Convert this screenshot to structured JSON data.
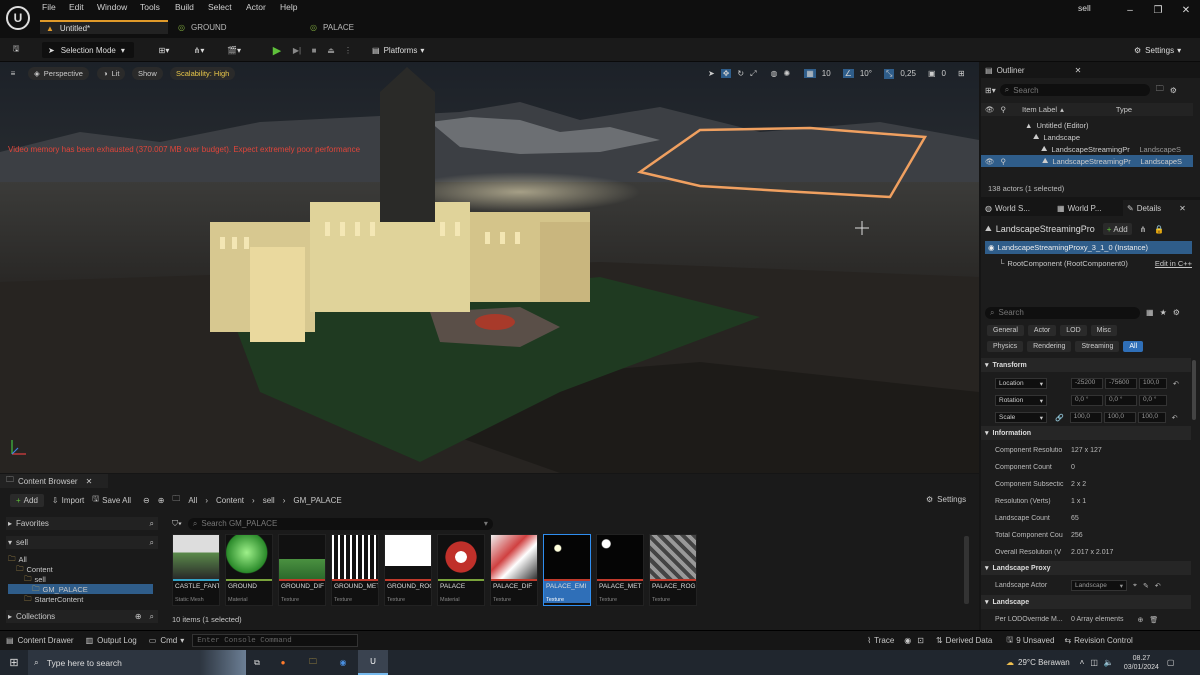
{
  "title": {
    "menus": [
      "File",
      "Edit",
      "Window",
      "Tools",
      "Build",
      "Select",
      "Actor",
      "Help"
    ],
    "tabs": [
      "Untitled*",
      "GROUND",
      "PALACE"
    ],
    "project": "sell"
  },
  "toolbar": {
    "selection_mode": "Selection Mode",
    "platforms": "Platforms",
    "settings": "Settings"
  },
  "viewport": {
    "perspective": "Perspective",
    "lit": "Lit",
    "show": "Show",
    "scalability": "Scalability: High",
    "warning": "Video memory has been exhausted (370.007 MB over budget). Expect extremely poor performance",
    "grid": "10",
    "angle": "10°",
    "scale": "0,25",
    "cam": "0"
  },
  "outliner": {
    "title": "Outliner",
    "search_placeholder": "Search",
    "col_label": "Item Label",
    "col_type": "Type",
    "rows": [
      {
        "label": "Untitled (Editor)",
        "type": ""
      },
      {
        "label": "Landscape",
        "type": ""
      },
      {
        "label": "LandscapeStreamingPr",
        "type": "LandscapeS"
      },
      {
        "label": "LandscapeStreamingPr",
        "type": "LandscapeS"
      }
    ],
    "count": "138 actors (1 selected)"
  },
  "details": {
    "tabs": [
      "World S...",
      "World P...",
      "Details"
    ],
    "actor_name": "LandscapeStreamingPro",
    "add": "Add",
    "instance": "LandscapeStreamingProxy_3_1_0 (Instance)",
    "root": "RootComponent (RootComponent0)",
    "edit_cpp": "Edit in C++",
    "search_placeholder": "Search",
    "categories_row1": [
      "General",
      "Actor",
      "LOD",
      "Misc"
    ],
    "categories_row2": [
      "Physics",
      "Rendering",
      "Streaming",
      "All"
    ],
    "transform_label": "Transform",
    "location": {
      "label": "Location",
      "x": "-25200",
      "y": "-75600",
      "z": "100,0"
    },
    "rotation": {
      "label": "Rotation",
      "x": "0,0 °",
      "y": "0,0 °",
      "z": "0,0 °"
    },
    "scale": {
      "label": "Scale",
      "x": "100,0",
      "y": "100,0",
      "z": "100,0"
    },
    "information_label": "Information",
    "info": [
      {
        "k": "Component Resolutio",
        "v": "127 x 127"
      },
      {
        "k": "Component Count",
        "v": "0"
      },
      {
        "k": "Component Subsectic",
        "v": "2 x 2"
      },
      {
        "k": "Resolution (Verts)",
        "v": "1 x 1"
      },
      {
        "k": "Landscape Count",
        "v": "65"
      },
      {
        "k": "Total Component Cou",
        "v": "256"
      },
      {
        "k": "Overall Resolution (V",
        "v": "2.017 x 2.017"
      }
    ],
    "proxy_label": "Landscape Proxy",
    "landscape_actor": "Landscape Actor",
    "landscape_actor_value": "Landscape",
    "landscape_label": "Landscape",
    "per_lod": "Per LODOverride M...",
    "per_lod_value": "0 Array elements"
  },
  "content_browser": {
    "title": "Content Browser",
    "add": "Add",
    "import": "Import",
    "save_all": "Save All",
    "path": [
      "All",
      "Content",
      "sell",
      "GM_PALACE"
    ],
    "settings": "Settings",
    "favorites": "Favorites",
    "root": "sell",
    "tree": [
      "All",
      "Content",
      "sell",
      "GM_PALACE",
      "StarterContent"
    ],
    "collections": "Collections",
    "search_placeholder": "Search GM_PALACE",
    "items": [
      {
        "name": "CASTLE_FANTASY",
        "type": "Static Mesh",
        "bar": "#34a3c6"
      },
      {
        "name": "GROUND",
        "type": "Material",
        "bar": "#7aa33c"
      },
      {
        "name": "GROUND_DIF",
        "type": "Texture",
        "bar": "#c0392b"
      },
      {
        "name": "GROUND_MET",
        "type": "Texture",
        "bar": "#c0392b"
      },
      {
        "name": "GROUND_ROG",
        "type": "Texture",
        "bar": "#c0392b"
      },
      {
        "name": "PALACE",
        "type": "Material",
        "bar": "#7aa33c"
      },
      {
        "name": "PALACE_DIF",
        "type": "Texture",
        "bar": "#c0392b"
      },
      {
        "name": "PALACE_EMI",
        "type": "Texture",
        "bar": "#c0392b"
      },
      {
        "name": "PALACE_MET",
        "type": "Texture",
        "bar": "#c0392b"
      },
      {
        "name": "PALACE_ROG",
        "type": "Texture",
        "bar": "#c0392b"
      }
    ],
    "count": "10 items (1 selected)"
  },
  "statusbar": {
    "content_drawer": "Content Drawer",
    "output_log": "Output Log",
    "cmd": "Cmd",
    "console_placeholder": "Enter Console Command",
    "trace": "Trace",
    "derived": "Derived Data",
    "unsaved": "9 Unsaved",
    "revision": "Revision Control"
  },
  "taskbar": {
    "search": "Type here to search",
    "weather": "29°C Berawan",
    "time": "08.27",
    "date": "03/01/2024"
  }
}
